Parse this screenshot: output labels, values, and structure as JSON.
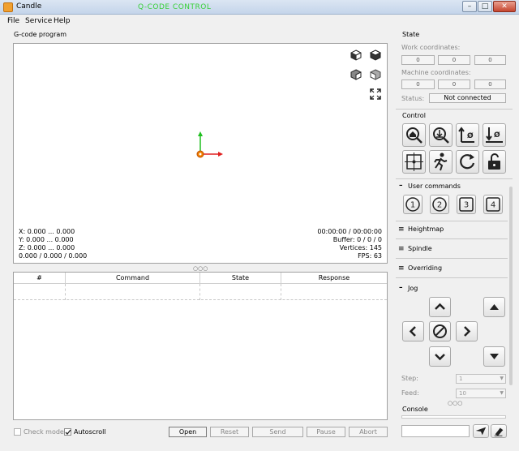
{
  "window": {
    "title": "Candle",
    "faded_caption": "Q-CODE CONTROL",
    "minimize": "–",
    "maximize": "□",
    "close": "✕"
  },
  "menu": {
    "file": "File",
    "service": "Service",
    "help": "Help"
  },
  "gcode": {
    "title": "G-code program",
    "coords": {
      "x": "X: 0.000 ... 0.000",
      "y": "Y: 0.000 ... 0.000",
      "z": "Z: 0.000 ... 0.000",
      "xyz": "0.000 / 0.000 / 0.000"
    },
    "stats": {
      "time": "00:00:00 / 00:00:00",
      "buffer": "Buffer: 0 / 0 / 0",
      "vertices": "Vertices: 145",
      "fps": "FPS: 63"
    },
    "splitter": "○○○"
  },
  "table": {
    "headers": [
      "#",
      "Command",
      "State",
      "Response"
    ]
  },
  "bottom": {
    "check_mode": "Check mode",
    "autoscroll": "Autoscroll",
    "open": "Open",
    "reset": "Reset",
    "send": "Send",
    "pause": "Pause",
    "abort": "Abort"
  },
  "state": {
    "title": "State",
    "work_label": "Work coordinates:",
    "work": [
      "0",
      "0",
      "0"
    ],
    "machine_label": "Machine coordinates:",
    "machine": [
      "0",
      "0",
      "0"
    ],
    "status_label": "Status:",
    "status_value": "Not connected"
  },
  "control": {
    "title": "Control"
  },
  "user_commands": {
    "title": "User commands",
    "buttons": [
      "1",
      "2",
      "3",
      "4"
    ]
  },
  "sections": {
    "heightmap": "Heightmap",
    "spindle": "Spindle",
    "overriding": "Overriding",
    "jog": "Jog"
  },
  "jog": {
    "step_label": "Step:",
    "step_value": "1",
    "feed_label": "Feed:",
    "feed_value": "10",
    "dots": "○○○"
  },
  "console": {
    "title": "Console",
    "input_placeholder": ""
  },
  "colors": {
    "accent_green": "#1fbf1f",
    "accent_red": "#e02020",
    "accent_orange": "#f08000"
  }
}
